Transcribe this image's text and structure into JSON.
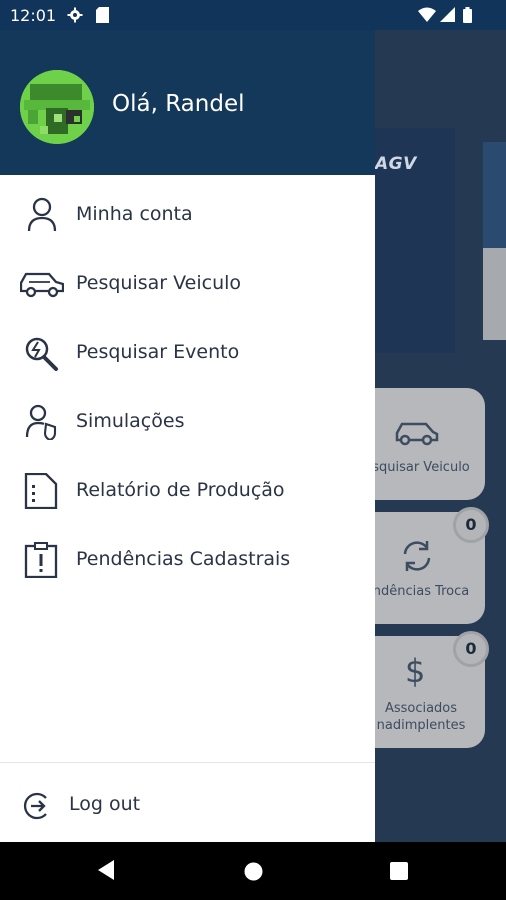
{
  "status_bar": {
    "time": "12:01"
  },
  "drawer": {
    "greeting": "Olá, Randel",
    "menu_items": [
      {
        "label": "Minha conta",
        "icon": "person-icon"
      },
      {
        "label": "Pesquisar Veiculo",
        "icon": "car-icon"
      },
      {
        "label": "Pesquisar Evento",
        "icon": "event-search-icon"
      },
      {
        "label": "Simulações",
        "icon": "simulation-icon"
      },
      {
        "label": "Relatório de Produção",
        "icon": "report-icon"
      },
      {
        "label": "Pendências Cadastrais",
        "icon": "pending-alert-icon"
      }
    ],
    "logout_label": "Log out"
  },
  "background": {
    "banner_logo": "AGV",
    "cards": [
      {
        "label": "squisar Veiculo"
      },
      {
        "label": "ndências Troca",
        "badge": "0"
      },
      {
        "label": "Associados\nnadimplentes",
        "badge": "0"
      }
    ]
  },
  "colors": {
    "header": "#133859",
    "accent_text": "#2b3446",
    "scrim": "#2a3c52"
  }
}
